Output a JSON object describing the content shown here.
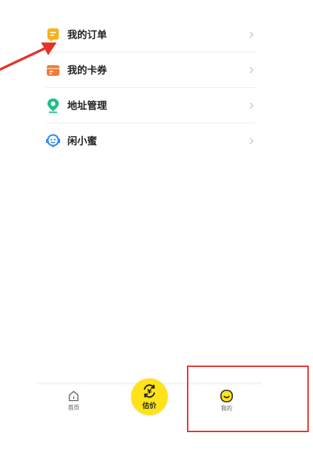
{
  "menu": {
    "items": [
      {
        "label": "我的订单",
        "icon": "order-icon",
        "color": "#f7b21f"
      },
      {
        "label": "我的卡券",
        "icon": "coupon-icon",
        "color": "#f47a3a"
      },
      {
        "label": "地址管理",
        "icon": "location-pin-icon",
        "color": "#1fbf8c"
      },
      {
        "label": "闲小蜜",
        "icon": "customer-service-icon",
        "color": "#2d8cf0"
      }
    ]
  },
  "tabbar": {
    "home_label": "首页",
    "estimate_symbol": "¥",
    "estimate_label": "估价",
    "me_label": "我的",
    "accent_color": "#ffe31a"
  },
  "annotations": {
    "color": "#e53329"
  }
}
